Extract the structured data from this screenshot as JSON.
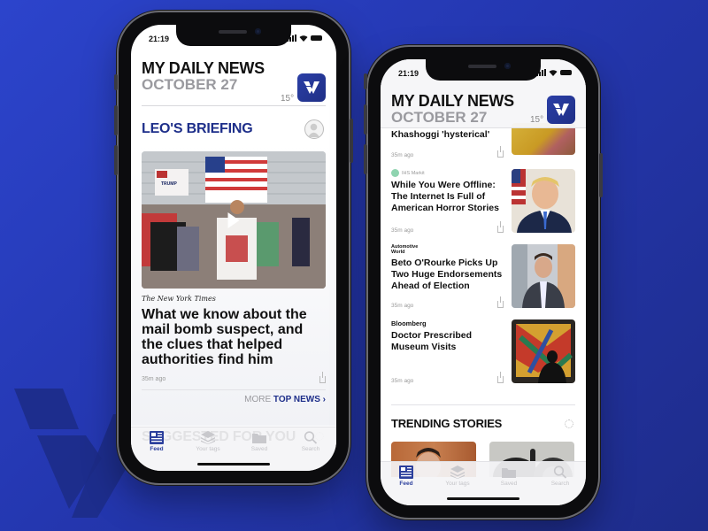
{
  "brand": {
    "accent": "#1e2f8a",
    "background_left": "#2c44cc",
    "background_right": "#1e2c8a",
    "logo_letter": "V"
  },
  "phone_left": {
    "status": {
      "time": "21:19"
    },
    "header": {
      "title": "MY DAILY NEWS",
      "date": "OCTOBER 27",
      "temperature": "15°"
    },
    "briefing": {
      "title": "LEO'S BRIEFING",
      "hero": {
        "media_type": "video",
        "source": "The New York Times",
        "headline": "What we know about the mail bomb suspect, and the clues that helped authorities find him",
        "time_ago": "35m ago"
      },
      "more_label": "MORE",
      "top_news_label": "TOP NEWS ›"
    },
    "suggested_title": "SUGGESTED FOR YOU",
    "tabs": [
      {
        "label": "Feed",
        "icon": "feed-icon",
        "active": true
      },
      {
        "label": "Your tags",
        "icon": "layers-icon",
        "active": false
      },
      {
        "label": "Saved",
        "icon": "folder-icon",
        "active": false
      },
      {
        "label": "Search",
        "icon": "search-icon",
        "active": false
      }
    ]
  },
  "phone_right": {
    "status": {
      "time": "21:19"
    },
    "header": {
      "title": "MY DAILY NEWS",
      "date": "OCTOBER 27",
      "temperature": "15°"
    },
    "articles": [
      {
        "source": "",
        "title": "Khashoggi 'hysterical'",
        "time_ago": "35m ago"
      },
      {
        "source": "IHS Markit",
        "title": "While You Were Offline: The Internet Is Full of American Horror Stories",
        "time_ago": "35m ago"
      },
      {
        "source": "Automotive World",
        "title": "Beto O'Rourke Picks Up Two Huge Endorsements Ahead of Election",
        "time_ago": "35m ago"
      },
      {
        "source": "Bloomberg",
        "title": "Doctor Prescribed Museum Visits",
        "time_ago": "35m ago"
      }
    ],
    "trending_title": "TRENDING STORIES",
    "tabs": [
      {
        "label": "Feed",
        "icon": "feed-icon",
        "active": true
      },
      {
        "label": "Your tags",
        "icon": "layers-icon",
        "active": false
      },
      {
        "label": "Saved",
        "icon": "folder-icon",
        "active": false
      },
      {
        "label": "Search",
        "icon": "search-icon",
        "active": false
      }
    ]
  }
}
